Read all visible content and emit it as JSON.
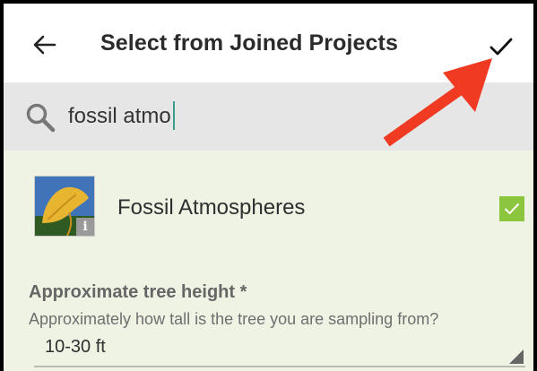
{
  "toolbar": {
    "title": "Select from Joined Projects",
    "back_icon": "arrow-left-icon",
    "confirm_icon": "checkmark-icon"
  },
  "search": {
    "value": "fossil atmo",
    "icon": "search-icon"
  },
  "projects": [
    {
      "name": "Fossil Atmospheres",
      "checked": true,
      "badge": "i"
    }
  ],
  "field": {
    "label": "Approximate tree height *",
    "description": "Approximately how tall is the tree you are sampling from?",
    "value": "10-30 ft"
  },
  "colors": {
    "accent_green": "#8cc63f",
    "list_background": "#eef3e4",
    "search_background": "#e6e6e6",
    "annotation_arrow": "#f03a22",
    "caret": "#3a9b8f"
  }
}
